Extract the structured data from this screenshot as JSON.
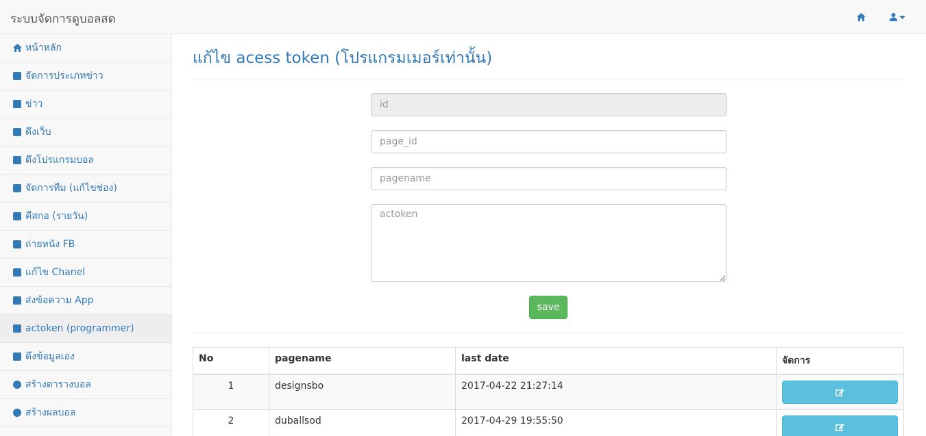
{
  "app": {
    "brand": "ระบบจัดการดูบอลสด"
  },
  "navbar": {
    "home_icon": "home-icon",
    "user_icon": "user-icon"
  },
  "sidebar": {
    "items": [
      {
        "label": "หน้าหลัก",
        "icon": "home-icon"
      },
      {
        "label": "จัดการประเภทข่าว",
        "icon": "square-icon"
      },
      {
        "label": "ข่าว",
        "icon": "square-icon"
      },
      {
        "label": "ดึงเว็บ",
        "icon": "square-icon"
      },
      {
        "label": "ดึงโปรแกรมบอล",
        "icon": "square-icon"
      },
      {
        "label": "จัดการทีม (แก้ไขช่อง)",
        "icon": "square-icon"
      },
      {
        "label": "คีสกอ (รายวัน)",
        "icon": "square-icon"
      },
      {
        "label": "ถ่ายหนัง FB",
        "icon": "square-icon"
      },
      {
        "label": "แก้ไข Chanel",
        "icon": "square-icon"
      },
      {
        "label": "ส่งข้อความ App",
        "icon": "square-icon"
      },
      {
        "label": "actoken (programmer)",
        "icon": "square-icon",
        "active": true
      },
      {
        "label": "ดึงข้อมูลเอง",
        "icon": "square-icon"
      },
      {
        "label": "สร้างตารางบอล",
        "icon": "circle-icon"
      },
      {
        "label": "สร้างผลบอล",
        "icon": "circle-icon"
      }
    ]
  },
  "main": {
    "title": "แก้ไข acess token (โปรแกรมเมอร์เท่านั้น)",
    "form": {
      "id_placeholder": "id",
      "page_id_placeholder": "page_id",
      "pagename_placeholder": "pagename",
      "actoken_placeholder": "actoken",
      "save_label": "save"
    },
    "table": {
      "headers": [
        "No",
        "pagename",
        "last date",
        "จัดการ"
      ],
      "rows": [
        {
          "no": "1",
          "pagename": "designsbo",
          "last_date": "2017-04-22 21:27:14"
        },
        {
          "no": "2",
          "pagename": "duballsod",
          "last_date": "2017-04-29 19:55:50"
        }
      ]
    }
  },
  "colors": {
    "link": "#337ab7",
    "success": "#5cb85c",
    "info": "#5bc0de"
  }
}
